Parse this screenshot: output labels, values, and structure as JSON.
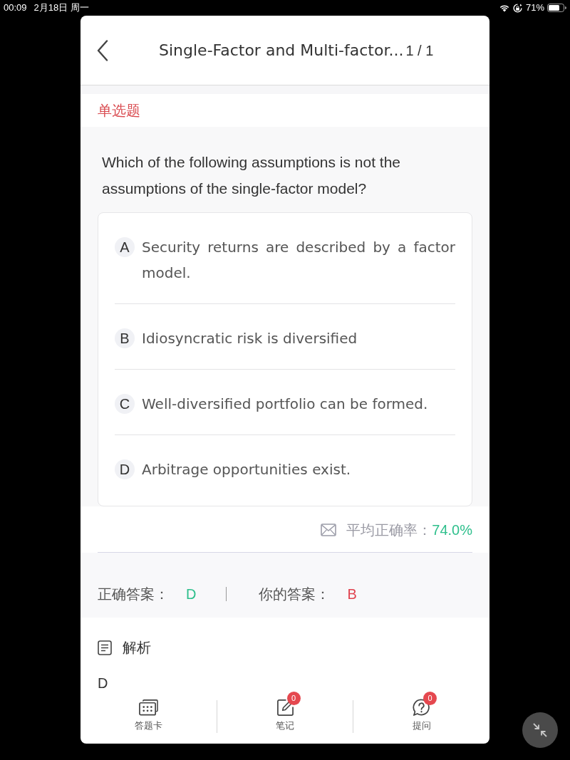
{
  "status_bar": {
    "time": "00:09",
    "date": "2月18日 周一",
    "battery": "71%"
  },
  "header": {
    "title": "Single-Factor and Multi-factor...",
    "counter": "1 / 1"
  },
  "question_type": "单选题",
  "question": "Which of the following assumptions is not the assumptions of the single-factor model?",
  "options": [
    {
      "letter": "A",
      "text": "Security returns are described by a factor model."
    },
    {
      "letter": "B",
      "text": "Idiosyncratic risk is diversified"
    },
    {
      "letter": "C",
      "text": "Well-diversified portfolio can be formed."
    },
    {
      "letter": "D",
      "text": "Arbitrage opportunities exist."
    }
  ],
  "average_accuracy": {
    "label": "平均正确率：",
    "value": "74.0%"
  },
  "answers": {
    "correct_label": "正确答案：",
    "correct_answer": "D",
    "your_label": "你的答案：",
    "your_answer": "B",
    "your_answer_correct": false
  },
  "analysis": {
    "title": "解析",
    "text": "D"
  },
  "bottom_nav": [
    {
      "kind": "sheet",
      "label": "答题卡"
    },
    {
      "kind": "note",
      "label": "笔记",
      "badge": "0"
    },
    {
      "kind": "ask",
      "label": "提问",
      "badge": "0"
    }
  ]
}
